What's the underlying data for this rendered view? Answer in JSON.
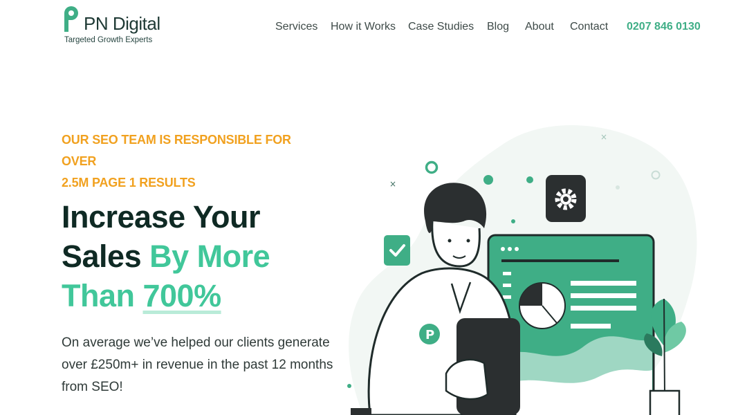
{
  "brand": {
    "name": "PN Digital",
    "tagline": "Targeted Growth Experts",
    "accent_color": "#41c79a",
    "highlight_color": "#f1a11f"
  },
  "nav": {
    "items": [
      "Services",
      "How it Works",
      "Case Studies",
      "Blog",
      "About",
      "Contact"
    ],
    "phone": "0207 846 0130"
  },
  "hero": {
    "eyebrow_line1": "OUR SEO TEAM IS RESPONSIBLE FOR OVER",
    "eyebrow_line2": "2.5M PAGE 1 RESULTS",
    "headline_dark1": "Increase Your",
    "headline_dark2": "Sales ",
    "headline_green1": "By More",
    "headline_green2": "Than ",
    "headline_highlight": "700%",
    "subtext": "On average we’ve helped our clients generate over £250m+ in revenue in the past 12 months from SEO!"
  },
  "illustration": {
    "badge_letter": "P",
    "icons": [
      "gear-icon",
      "checkmark-icon",
      "pie-chart-icon",
      "plant-icon"
    ]
  }
}
